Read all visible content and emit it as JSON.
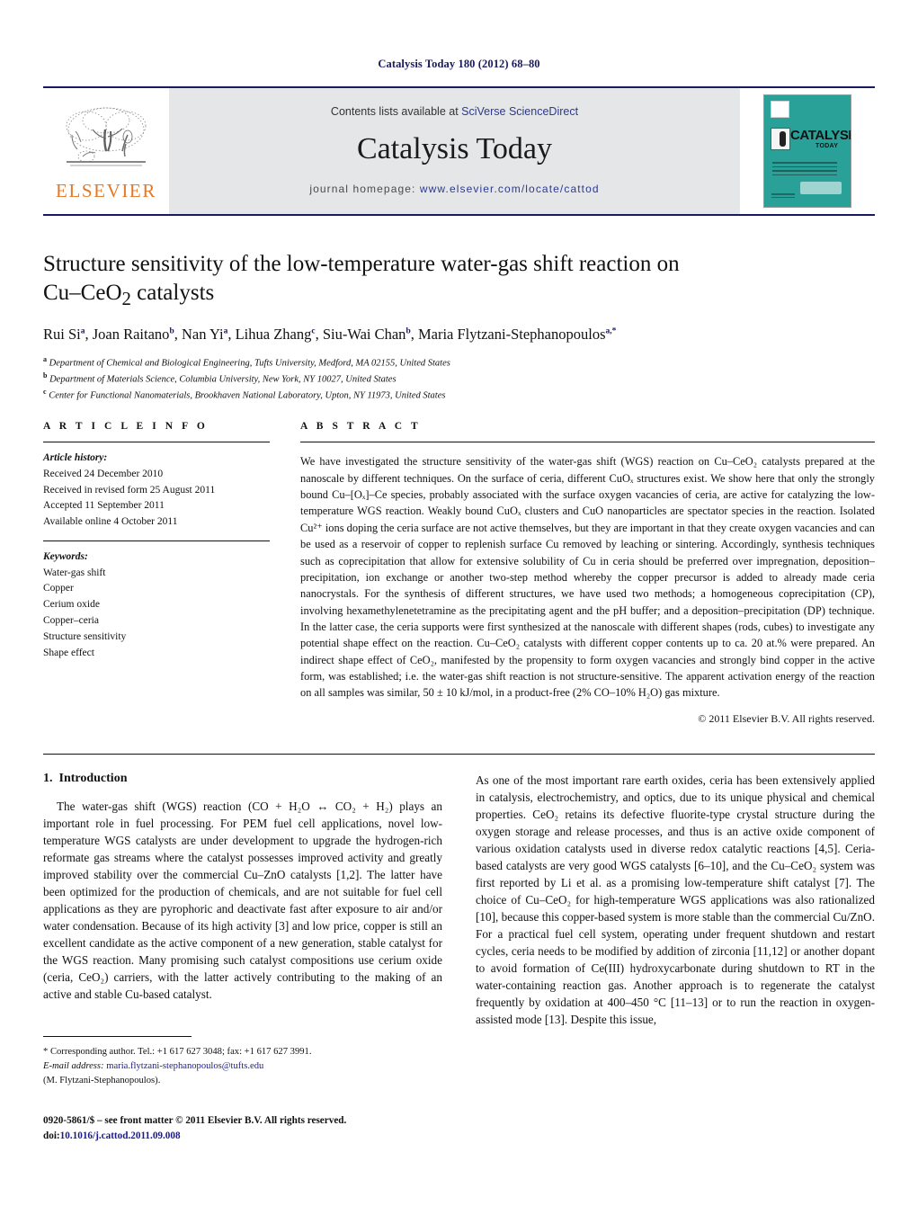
{
  "running_head": "Catalysis Today 180 (2012) 68–80",
  "masthead": {
    "contents_prefix": "Contents lists available at ",
    "contents_link": "SciVerse ScienceDirect",
    "journal_title": "Catalysis Today",
    "homepage_prefix": "journal homepage: ",
    "homepage_url": "www.elsevier.com/locate/cattod",
    "elsevier_wordmark": "ELSEVIER",
    "cover_title": "CATALYSIS",
    "cover_subtitle": "TODAY"
  },
  "article": {
    "title_line1": "Structure sensitivity of the low-temperature water-gas shift reaction on",
    "title_line2_pre": "Cu–CeO",
    "title_line2_sub": "2",
    "title_line2_post": " catalysts",
    "authors": [
      {
        "name": "Rui Si",
        "marks": "a"
      },
      {
        "name": "Joan Raitano",
        "marks": "b"
      },
      {
        "name": "Nan Yi",
        "marks": "a"
      },
      {
        "name": "Lihua Zhang",
        "marks": "c"
      },
      {
        "name": "Siu-Wai Chan",
        "marks": "b"
      },
      {
        "name": "Maria Flytzani-Stephanopoulos",
        "marks": "a,*"
      }
    ],
    "affiliations": [
      {
        "mark": "a",
        "text": "Department of Chemical and Biological Engineering, Tufts University, Medford, MA 02155, United States"
      },
      {
        "mark": "b",
        "text": "Department of Materials Science, Columbia University, New York, NY 10027, United States"
      },
      {
        "mark": "c",
        "text": "Center for Functional Nanomaterials, Brookhaven National Laboratory, Upton, NY 11973, United States"
      }
    ]
  },
  "article_info": {
    "heading": "A R T I C L E   I N F O",
    "history_label": "Article history:",
    "history": [
      "Received 24 December 2010",
      "Received in revised form 25 August 2011",
      "Accepted 11 September 2011",
      "Available online 4 October 2011"
    ],
    "keywords_label": "Keywords:",
    "keywords": [
      "Water-gas shift",
      "Copper",
      "Cerium oxide",
      "Copper–ceria",
      "Structure sensitivity",
      "Shape effect"
    ]
  },
  "abstract": {
    "heading": "A B S T R A C T",
    "text": "We have investigated the structure sensitivity of the water-gas shift (WGS) reaction on Cu–CeO₂ catalysts prepared at the nanoscale by different techniques. On the surface of ceria, different CuOₓ structures exist. We show here that only the strongly bound Cu–[Oₓ]–Ce species, probably associated with the surface oxygen vacancies of ceria, are active for catalyzing the low-temperature WGS reaction. Weakly bound CuOₓ clusters and CuO nanoparticles are spectator species in the reaction. Isolated Cu²⁺ ions doping the ceria surface are not active themselves, but they are important in that they create oxygen vacancies and can be used as a reservoir of copper to replenish surface Cu removed by leaching or sintering. Accordingly, synthesis techniques such as coprecipitation that allow for extensive solubility of Cu in ceria should be preferred over impregnation, deposition–precipitation, ion exchange or another two-step method whereby the copper precursor is added to already made ceria nanocrystals. For the synthesis of different structures, we have used two methods; a homogeneous coprecipitation (CP), involving hexamethylenetetramine as the precipitating agent and the pH buffer; and a deposition–precipitation (DP) technique. In the latter case, the ceria supports were first synthesized at the nanoscale with different shapes (rods, cubes) to investigate any potential shape effect on the reaction. Cu–CeO₂ catalysts with different copper contents up to ca. 20 at.% were prepared. An indirect shape effect of CeO₂, manifested by the propensity to form oxygen vacancies and strongly bind copper in the active form, was established; i.e. the water-gas shift reaction is not structure-sensitive. The apparent activation energy of the reaction on all samples was similar, 50 ± 10 kJ/mol, in a product-free (2% CO–10% H₂O) gas mixture.",
    "copyright": "© 2011 Elsevier B.V. All rights reserved."
  },
  "introduction": {
    "number": "1.",
    "title": "Introduction",
    "para1": "The water-gas shift (WGS) reaction (CO + H₂O ↔ CO₂ + H₂) plays an important role in fuel processing. For PEM fuel cell applications, novel low-temperature WGS catalysts are under development to upgrade the hydrogen-rich reformate gas streams where the catalyst possesses improved activity and greatly improved stability over the commercial Cu–ZnO catalysts [1,2]. The latter have been optimized for the production of chemicals, and are not suitable for fuel cell applications as they are pyrophoric and deactivate fast after exposure to air and/or water condensation. Because of its high activity [3] and low price, copper is still an excellent candidate as the active component of a new generation, stable catalyst for the WGS reaction. Many promising such catalyst compositions use cerium oxide (ceria, CeO₂) carriers, with the latter actively contributing to the making of an active and stable Cu-based catalyst.",
    "para2": "As one of the most important rare earth oxides, ceria has been extensively applied in catalysis, electrochemistry, and optics, due to its unique physical and chemical properties. CeO₂ retains its defective fluorite-type crystal structure during the oxygen storage and release processes, and thus is an active oxide component of various oxidation catalysts used in diverse redox catalytic reactions [4,5]. Ceria-based catalysts are very good WGS catalysts [6–10], and the Cu–CeO₂ system was first reported by Li et al. as a promising low-temperature shift catalyst [7]. The choice of Cu–CeO₂ for high-temperature WGS applications was also rationalized [10], because this copper-based system is more stable than the commercial Cu/ZnO. For a practical fuel cell system, operating under frequent shutdown and restart cycles, ceria needs to be modified by addition of zirconia [11,12] or another dopant to avoid formation of Ce(III) hydroxycarbonate during shutdown to RT in the water-containing reaction gas. Another approach is to regenerate the catalyst frequently by oxidation at 400–450 °C [11–13] or to run the reaction in oxygen-assisted mode [13]. Despite this issue,"
  },
  "footnotes": {
    "corresponding": "* Corresponding author. Tel.: +1 617 627 3048; fax: +1 617 627 3991.",
    "email_label": "E-mail address:",
    "email": "maria.flytzani-stephanopoulos@tufts.edu",
    "email_owner": "(M. Flytzani-Stephanopoulos).",
    "issn_line": "0920-5861/$ – see front matter © 2011 Elsevier B.V. All rights reserved.",
    "doi_label": "doi:",
    "doi_value": "10.1016/j.cattod.2011.09.008"
  },
  "colors": {
    "header_navy": "#1a1a5e",
    "link_blue": "#2b3a8f",
    "ref_blue": "#1a4fa0",
    "elsevier_orange": "#e87722",
    "masthead_gray": "#e4e6e8",
    "cover_teal": "#2aa198"
  }
}
